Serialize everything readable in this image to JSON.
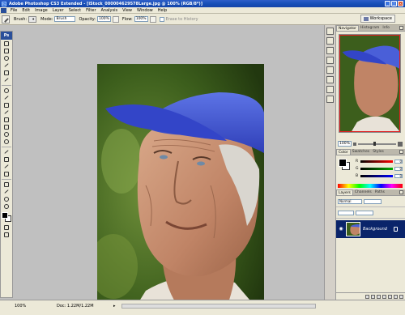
{
  "window": {
    "title": "Adobe Photoshop CS3 Extended - [iStock_000004629578Large.jpg @ 100% (RGB/8*)]",
    "app_icon": "Ps",
    "controls": {
      "minimize": "_",
      "maximize": "□",
      "close": "×"
    }
  },
  "menubar": {
    "items": [
      "File",
      "Edit",
      "Image",
      "Layer",
      "Select",
      "Filter",
      "Analysis",
      "View",
      "Window",
      "Help"
    ]
  },
  "options": {
    "brush_label": "Brush:",
    "mode_label": "Mode:",
    "mode_value": "Brush",
    "opacity_label": "Opacity:",
    "opacity_value": "100%",
    "flow_label": "Flow:",
    "flow_value": "100%",
    "erase_history": "Erase to History",
    "workspace_label": "Workspace"
  },
  "toolbox": {
    "logo": "Ps"
  },
  "navigator": {
    "tabs": [
      "Navigator",
      "Histogram",
      "Info"
    ],
    "zoom": "100%"
  },
  "color_panel": {
    "tabs": [
      "Color",
      "Swatches",
      "Styles"
    ],
    "channels": [
      {
        "label": "R",
        "value": "0",
        "color": "#ff0000"
      },
      {
        "label": "G",
        "value": "0",
        "color": "#00aa00"
      },
      {
        "label": "B",
        "value": "0",
        "color": "#0000ff"
      }
    ]
  },
  "layers_panel": {
    "tabs": [
      "Layers",
      "Channels",
      "Paths"
    ],
    "blend_mode": "Normal",
    "layer_name": "Background"
  },
  "statusbar": {
    "zoom": "100%",
    "doc": "Doc: 1.22M/1.22M"
  }
}
